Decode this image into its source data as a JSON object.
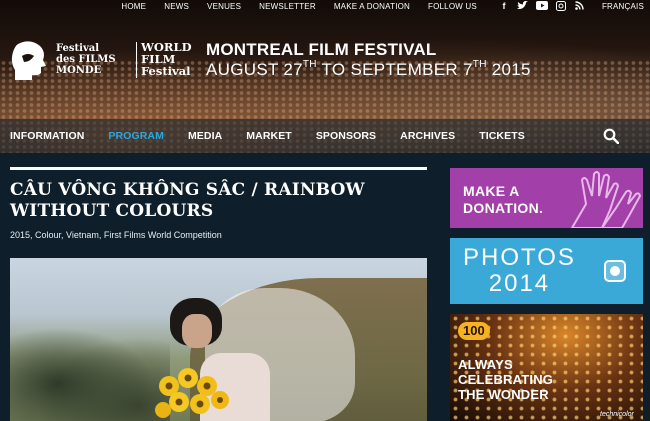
{
  "topnav": {
    "items": [
      "HOME",
      "NEWS",
      "VENUES",
      "NEWSLETTER",
      "MAKE A DONATION",
      "FOLLOW US"
    ],
    "social_icons": [
      "facebook-icon",
      "twitter-icon",
      "youtube-icon",
      "instagram-icon",
      "rss-icon"
    ],
    "language": "FRANÇAIS"
  },
  "logo": {
    "left_lines": [
      "Festival",
      "des FILMS",
      "MONDE"
    ],
    "right_lines": [
      "WORLD",
      "FILM",
      "Festival"
    ]
  },
  "festival": {
    "title": "MONTREAL FILM FESTIVAL",
    "dates_part1": "AUGUST 27",
    "sup1": "TH",
    "dates_part2": " TO SEPTEMBER 7",
    "sup2": "TH",
    "dates_part3": " 2015"
  },
  "mainnav": {
    "items": [
      "INFORMATION",
      "PROGRAM",
      "MEDIA",
      "MARKET",
      "SPONSORS",
      "ARCHIVES",
      "TICKETS"
    ],
    "active": "PROGRAM"
  },
  "film": {
    "title": "CÂU VÔNG KHÔNG SÂC / RAINBOW WITHOUT COLOURS",
    "meta": "2015, Colour, Vietnam, First Films World Competition"
  },
  "sidebar": {
    "donate": {
      "line1": "MAKE A",
      "line2": "DONATION."
    },
    "photos": {
      "line1": "PHOTOS",
      "line2": "2014"
    },
    "technicolor": {
      "badge": "100",
      "line1": "ALWAYS",
      "line2": "CELEBRATING",
      "line3": "THE WONDER",
      "brand": "technicolor"
    }
  },
  "colors": {
    "accent": "#2aa8e0",
    "background": "#0e1f2b",
    "donate": "#a23fa8",
    "photos": "#3aa9d8"
  }
}
